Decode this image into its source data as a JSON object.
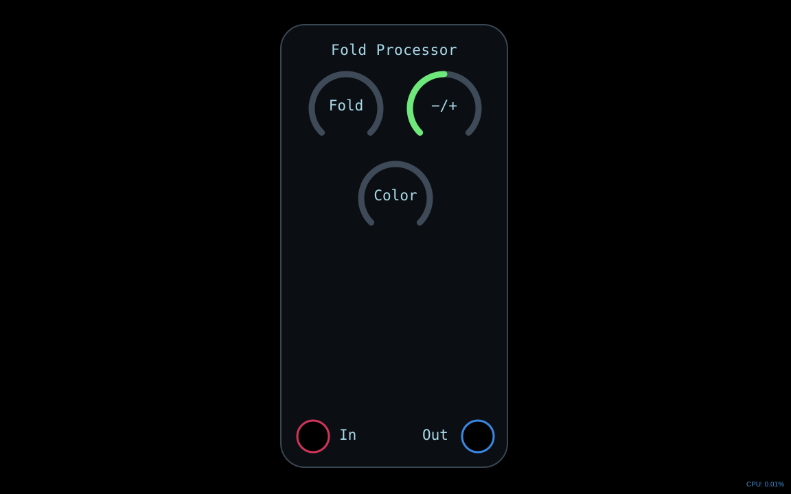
{
  "module": {
    "title": "Fold Processor"
  },
  "knobs": [
    {
      "label": "Fold",
      "value": 0.0,
      "track_color": "#3e4a57",
      "value_color": "#6ee87a"
    },
    {
      "label": "−/+",
      "value": 0.5,
      "track_color": "#3e4a57",
      "value_color": "#6ee87a"
    },
    {
      "label": "Color",
      "value": 0.0,
      "track_color": "#3e4a57",
      "value_color": "#6ee87a"
    }
  ],
  "ports": {
    "input": {
      "label": "In",
      "color": "#d0345a"
    },
    "output": {
      "label": "Out",
      "color": "#3a86e0"
    }
  },
  "status": {
    "cpu": "CPU: 0.01%"
  }
}
